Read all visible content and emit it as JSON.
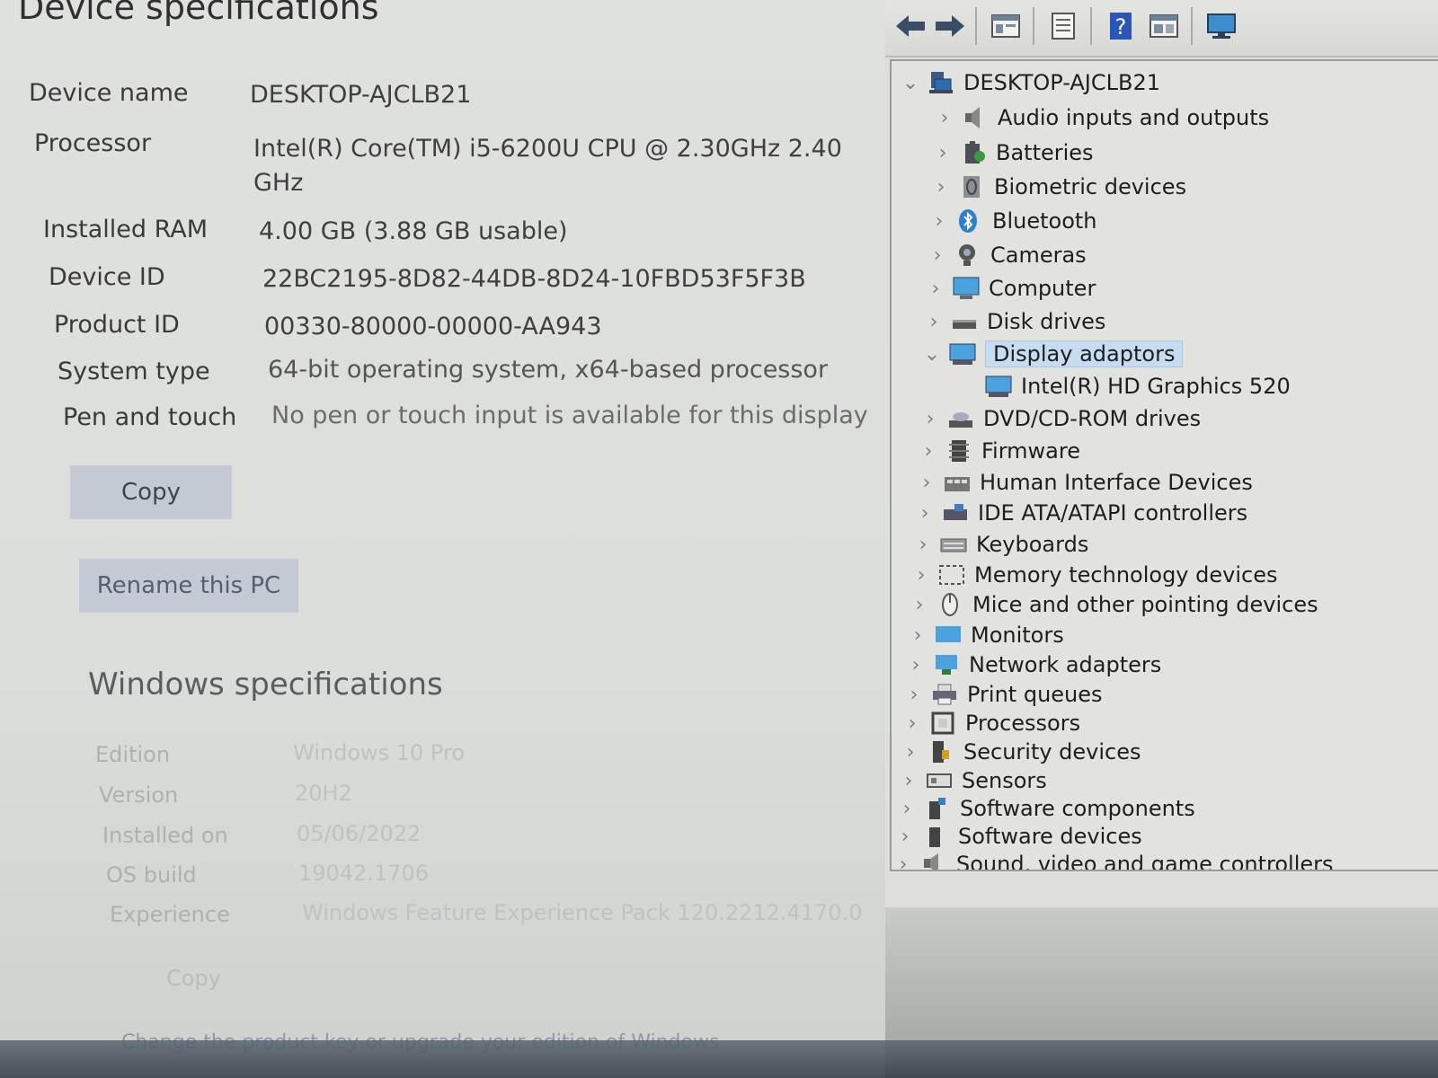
{
  "settings": {
    "heading": "Device specifications",
    "specs": [
      {
        "label": "Device name",
        "value": "DESKTOP-AJCLB21"
      },
      {
        "label": "Processor",
        "value": "Intel(R) Core(TM) i5-6200U CPU @ 2.30GHz   2.40",
        "value2": "GHz"
      },
      {
        "label": "Installed RAM",
        "value": "4.00 GB (3.88 GB usable)"
      },
      {
        "label": "Device ID",
        "value": "22BC2195-8D82-44DB-8D24-10FBD53F5F3B"
      },
      {
        "label": "Product ID",
        "value": "00330-80000-00000-AA943"
      },
      {
        "label": "System type",
        "value": "64-bit operating system, x64-based processor"
      },
      {
        "label": "Pen and touch",
        "value": "No pen or touch input is available for this display"
      }
    ],
    "copy_button": "Copy",
    "rename_button": "Rename this PC",
    "windows_heading": "Windows specifications",
    "windows_specs": [
      {
        "label": "Edition",
        "value": "Windows 10 Pro"
      },
      {
        "label": "Version",
        "value": "20H2"
      },
      {
        "label": "Installed on",
        "value": "05/06/2022"
      },
      {
        "label": "OS build",
        "value": "19042.1706"
      },
      {
        "label": "Experience",
        "value": "Windows Feature Experience Pack 120.2212.4170.0"
      }
    ],
    "windows_copy": "Copy",
    "footer_link": "Change the product key or upgrade your edition of Windows"
  },
  "device_manager": {
    "toolbar": [
      "back-icon",
      "forward-icon",
      "properties-view-icon",
      "properties-icon",
      "help-icon",
      "show-hidden-icon",
      "monitor-icon"
    ],
    "root": "DESKTOP-AJCLB21",
    "categories": [
      "Audio inputs and outputs",
      "Batteries",
      "Biometric devices",
      "Bluetooth",
      "Cameras",
      "Computer",
      "Disk drives",
      "Display adaptors",
      "Intel(R) HD Graphics 520",
      "DVD/CD-ROM drives",
      "Firmware",
      "Human Interface Devices",
      "IDE ATA/ATAPI controllers",
      "Keyboards",
      "Memory technology devices",
      "Mice and other pointing devices",
      "Monitors",
      "Network adapters",
      "Print queues",
      "Processors",
      "Security devices",
      "Sensors",
      "Software components",
      "Software devices",
      "Sound, video and game controllers"
    ],
    "colors": {
      "selected_bg": "#c6dcf0",
      "accent": "#2f7fd0"
    }
  }
}
